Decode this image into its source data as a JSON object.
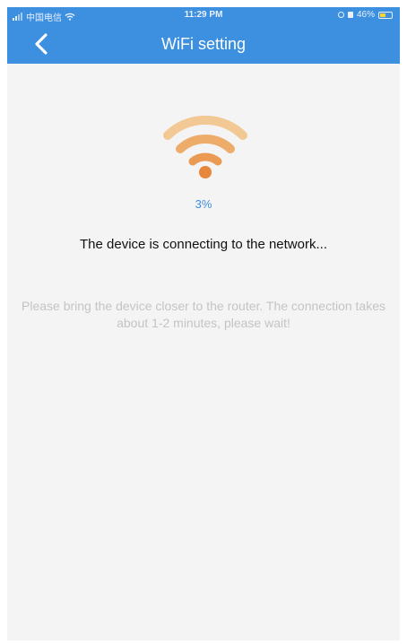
{
  "status_bar": {
    "carrier": "中国电信",
    "time": "11:29 PM",
    "battery": "46%"
  },
  "header": {
    "title": "WiFi setting",
    "back_icon": "chevron-left-icon"
  },
  "main": {
    "status_icon": "wifi-icon",
    "progress": "3%",
    "message": "The device is connecting to the network...",
    "hint": "Please bring the device closer to the router. The connection takes about 1-2 minutes, please wait!"
  },
  "colors": {
    "header": "#3d8fe0",
    "accent": "#3d8fe0",
    "wifi_light": "#f2c894",
    "wifi_dark": "#e8863a",
    "background": "#f4f4f4"
  }
}
